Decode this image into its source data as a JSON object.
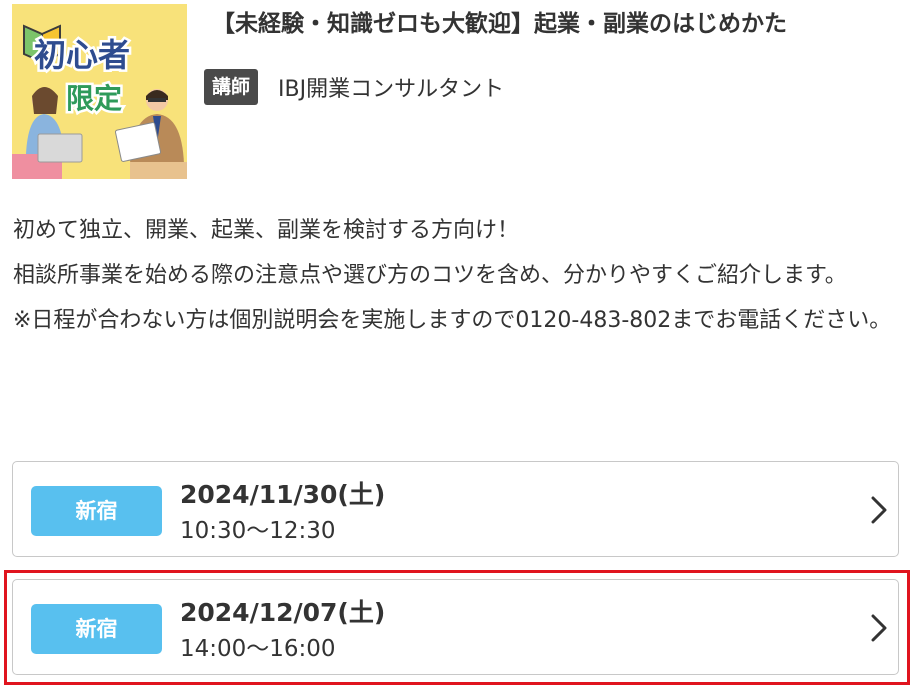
{
  "thumbnail": {
    "badge_line1": "初心者",
    "badge_line2": "限定"
  },
  "seminar": {
    "title": "【未経験・知識ゼロも大歓迎】起業・副業のはじめかた",
    "instructor_label": "講師",
    "instructor_name": "IBJ開業コンサルタント"
  },
  "description": {
    "line1": "初めて独立、開業、起業、副業を検討する方向け！",
    "line2": "相談所事業を始める際の注意点や選び方のコツを含め、分かりやすくご紹介します。",
    "line3": "※日程が合わない方は個別説明会を実施しますので0120-483-802までお電話ください。"
  },
  "sessions": [
    {
      "location": "新宿",
      "date": "2024/11/30(土)",
      "time": "10:30～12:30"
    },
    {
      "location": "新宿",
      "date": "2024/12/07(土)",
      "time": "14:00～16:00"
    }
  ],
  "colors": {
    "location_badge": "#58c0ef",
    "instructor_badge": "#4a4a4a",
    "highlight": "#e0141e",
    "thumbnail_bg": "#f8e27a"
  },
  "icons": {
    "chevron": "chevron-right-icon"
  }
}
